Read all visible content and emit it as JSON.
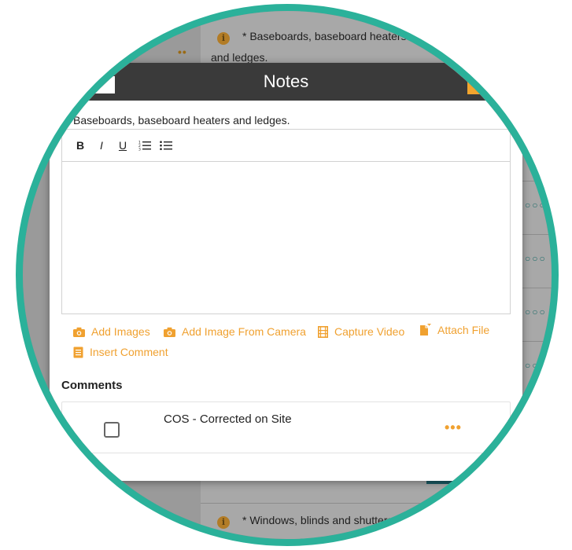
{
  "background": {
    "row1_text_a": "* Baseboards, baseboard heaters",
    "row1_text_b": "and ledges.",
    "row_bottom_text": "* Windows, blinds and shutters",
    "more_dots": "••",
    "row_dots": "○○○",
    "info_glyph": "i"
  },
  "modal": {
    "title": "Notes",
    "question": "Baseboards, baseboard heaters and ledges.",
    "toolbar": {
      "bold": "B",
      "italic": "I",
      "underline": "U"
    },
    "actions": {
      "add_images": "Add Images",
      "add_image_camera": "Add Image From Camera",
      "capture_video": "Capture Video",
      "attach_file": "Attach File",
      "insert_comment": "Insert Comment"
    },
    "comments_heading": "Comments",
    "comments": [
      {
        "text": "COS - Corrected on Site",
        "checked": false,
        "more": "•••"
      }
    ]
  },
  "colors": {
    "accent": "#f0a130",
    "ring": "#2bb19a",
    "header": "#3a3a3a"
  },
  "icons": [
    "camera-icon",
    "film-icon",
    "file-add-icon",
    "document-icon",
    "ordered-list-icon",
    "bullet-list-icon",
    "info-icon",
    "more-icon"
  ]
}
